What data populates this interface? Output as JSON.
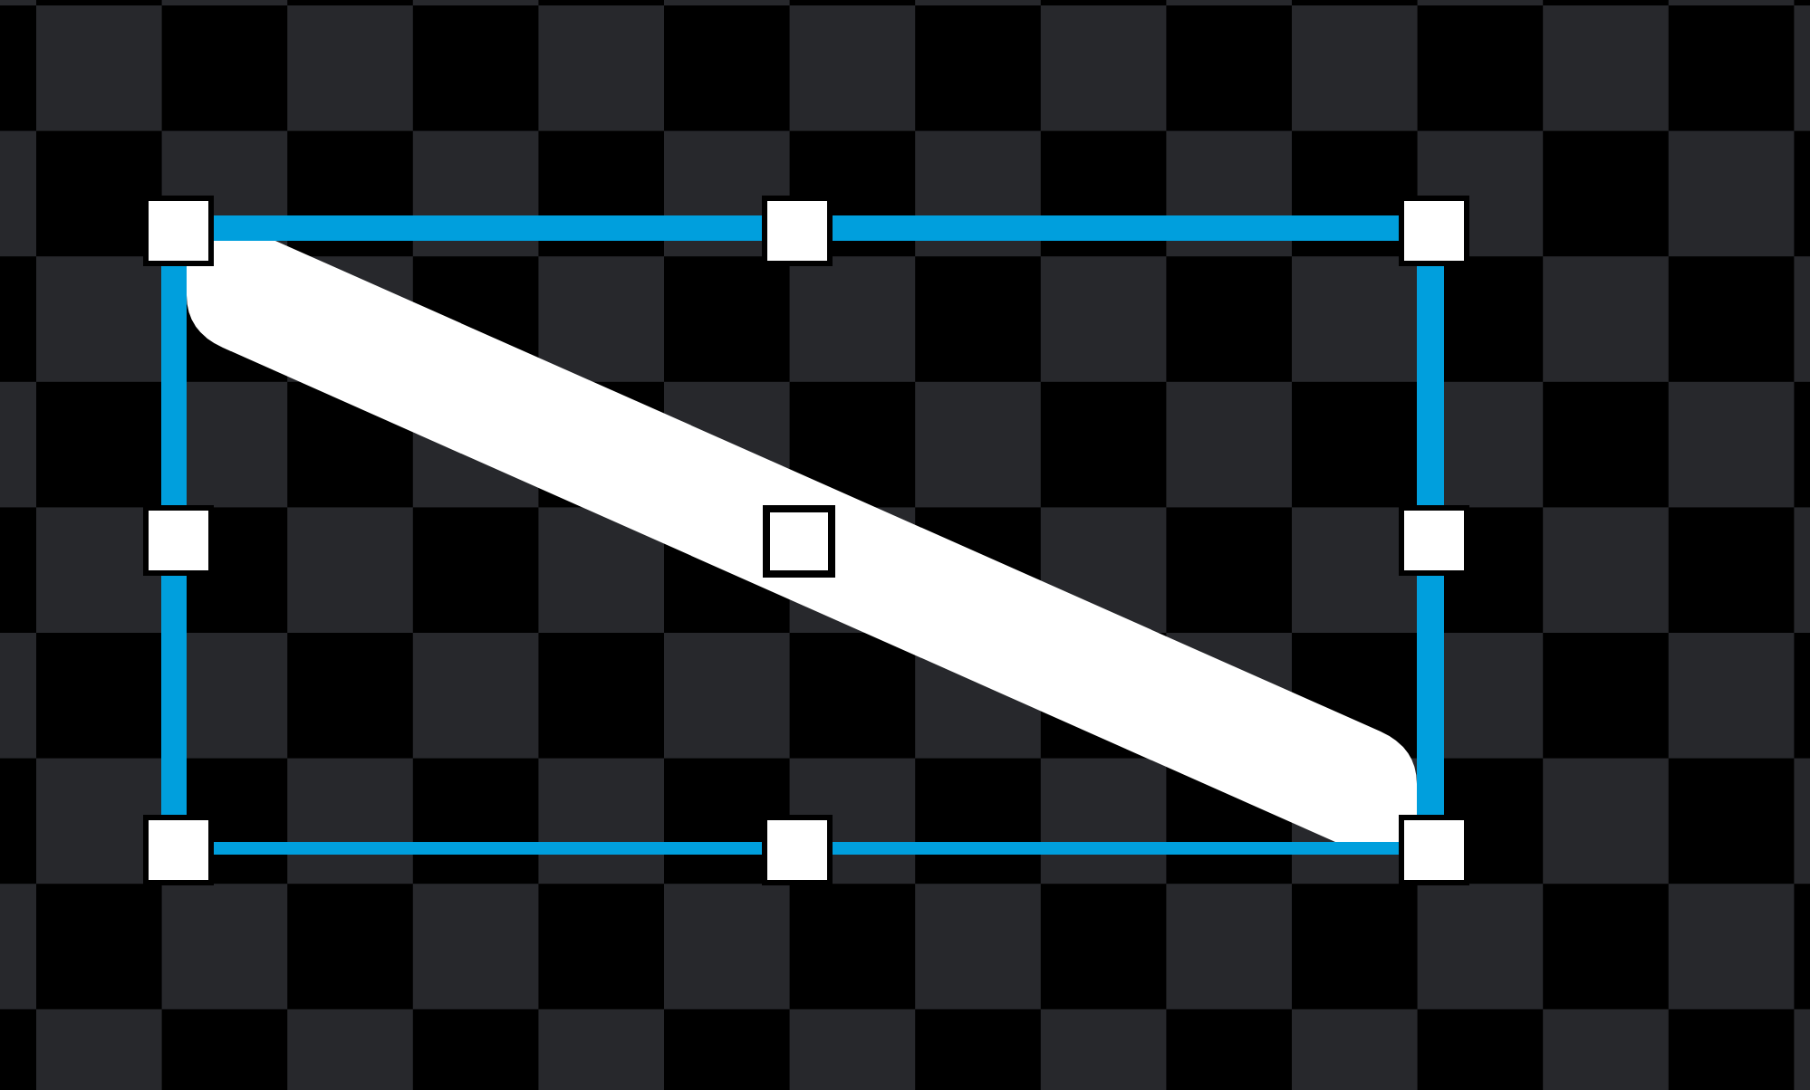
{
  "canvas": {
    "shapes": [
      {
        "kind": "line",
        "selected": true
      }
    ]
  }
}
